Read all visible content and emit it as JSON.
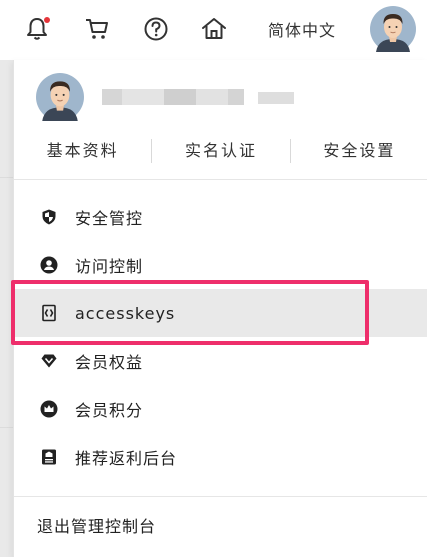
{
  "topbar": {
    "language_label": "简体中文",
    "notification_dot_color": "#e5353a",
    "icons": [
      "bell-icon",
      "cart-icon",
      "help-icon",
      "home-icon"
    ]
  },
  "profile_tabs": [
    "基本资料",
    "实名认证",
    "安全设置"
  ],
  "menu": [
    {
      "label": "安全管控",
      "icon": "shield-icon"
    },
    {
      "label": "访问控制",
      "icon": "user-circle-icon"
    },
    {
      "label": "accesskeys",
      "icon": "accesskey-icon"
    },
    {
      "label": "会员权益",
      "icon": "diamond-icon"
    },
    {
      "label": "会员积分",
      "icon": "crown-icon"
    },
    {
      "label": "推荐返利后台",
      "icon": "document-icon"
    }
  ],
  "logout_label": "退出管理控制台",
  "highlight_color": "#ee2e6b"
}
